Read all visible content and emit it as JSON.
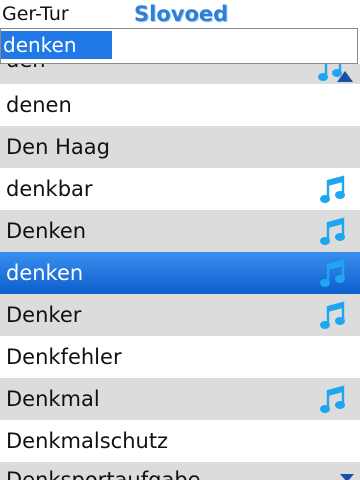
{
  "header": {
    "language_pair": "Ger-Tur",
    "logo": "Slovoed"
  },
  "search": {
    "value": "denken"
  },
  "list": {
    "partial_top": "den",
    "rows": [
      {
        "word": "denen",
        "sound": false
      },
      {
        "word": "Den Haag",
        "sound": false
      },
      {
        "word": "denkbar",
        "sound": true
      },
      {
        "word": "Denken",
        "sound": true
      },
      {
        "word": "denken",
        "sound": true,
        "selected": true
      },
      {
        "word": "Denker",
        "sound": true
      },
      {
        "word": "Denkfehler",
        "sound": false
      },
      {
        "word": "Denkmal",
        "sound": true
      },
      {
        "word": "Denkmalschutz",
        "sound": false
      }
    ],
    "partial_bottom": "Denksportaufgabe"
  },
  "icons": {
    "sound": "music-note-icon",
    "scroll_up": "scroll-up-arrow-icon",
    "scroll_down": "scroll-down-arrow-icon"
  },
  "colors": {
    "selection": "#1f78e6",
    "logo": "#2f7fd9",
    "stripe": "#dcdcdc",
    "note": "#1ea7ef"
  }
}
